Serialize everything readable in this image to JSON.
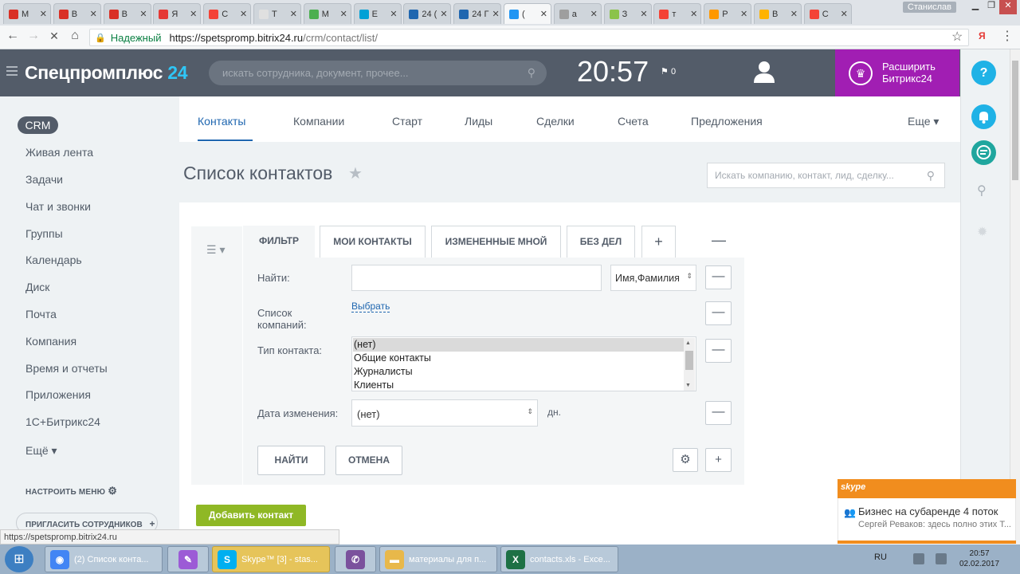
{
  "browser": {
    "tabs": [
      {
        "label": "М",
        "color": "#d93025"
      },
      {
        "label": "В",
        "color": "#d93025"
      },
      {
        "label": "В",
        "color": "#d93025"
      },
      {
        "label": "Я",
        "color": "#e53935"
      },
      {
        "label": "С",
        "color": "#f44336"
      },
      {
        "label": "Т",
        "color": "#e0e0e0"
      },
      {
        "label": "М",
        "color": "#4caf50"
      },
      {
        "label": "Е",
        "color": "#00a1d6"
      },
      {
        "label": "24 (",
        "color": "#2067b0"
      },
      {
        "label": "24 Г",
        "color": "#2067b0"
      },
      {
        "label": "(",
        "color": "#2196f3"
      },
      {
        "label": "а",
        "color": "#9e9e9e"
      },
      {
        "label": "З",
        "color": "#8bc34a"
      },
      {
        "label": "т",
        "color": "#f44336"
      },
      {
        "label": "Р",
        "color": "#ff9800"
      },
      {
        "label": "В",
        "color": "#ffb300"
      },
      {
        "label": "С",
        "color": "#f44336"
      }
    ],
    "window_user": "Станислав",
    "secure_label": "Надежный",
    "url_host": "https://spetspromp.bitrix24.ru",
    "url_path": "/crm/contact/list/",
    "status_url": "https://spetspromp.bitrix24.ru"
  },
  "header": {
    "logo_text": "Спецпромплюс",
    "logo_num": "24",
    "search_placeholder": "искать сотрудника, документ, прочее...",
    "clock": "20:57",
    "flag_count": "0",
    "expand_line1": "Расширить",
    "expand_line2": "Битрикс24",
    "help": "?"
  },
  "leftmenu": {
    "crm": "CRM",
    "items": [
      "Живая лента",
      "Задачи",
      "Чат и звонки",
      "Группы",
      "Календарь",
      "Диск",
      "Почта",
      "Компания",
      "Время и отчеты",
      "Приложения",
      "1С+Битрикс24",
      "Ещё ▾"
    ],
    "configure": "НАСТРОИТЬ МЕНЮ",
    "invite": "ПРИГЛАСИТЬ СОТРУДНИКОВ"
  },
  "topnav": {
    "items": [
      "Контакты",
      "Компании",
      "Старт",
      "Лиды",
      "Сделки",
      "Счета",
      "Предложения"
    ],
    "more": "Еще ▾"
  },
  "page": {
    "title": "Список контактов",
    "search_placeholder": "Искать компанию, контакт, лид, сделку..."
  },
  "filter": {
    "tabs": [
      "ФИЛЬТР",
      "МОИ КОНТАКТЫ",
      "ИЗМЕНЕННЫЕ МНОЙ",
      "БЕЗ ДЕЛ"
    ],
    "find_label": "Найти:",
    "find_field_select": "Имя,Фамилия",
    "companies_label": "Список компаний:",
    "choose_link": "Выбрать",
    "type_label": "Тип контакта:",
    "type_options": [
      "(нет)",
      "Общие контакты",
      "Журналисты",
      "Клиенты"
    ],
    "date_label": "Дата изменения:",
    "date_value": "(нет)",
    "days_suffix": "дн.",
    "find_button": "НАЙТИ",
    "cancel_button": "ОТМЕНА"
  },
  "add_contact": "Добавить контакт",
  "skype": {
    "logo": "skype",
    "title": "Бизнес на субаренде 4 поток",
    "message": "Сергей Реваков: здесь полно этих Т..."
  },
  "taskbar": {
    "items": [
      {
        "label": "(2) Список конта...",
        "icon": "chrome-icon",
        "color": "#4285f4",
        "glyph": "◉"
      },
      {
        "label": "",
        "icon": "feather-icon",
        "color": "#9c5bd6",
        "glyph": "✎"
      },
      {
        "label": "Skype™ [3] - stas...",
        "icon": "skype-icon",
        "color": "#00aff0",
        "glyph": "S"
      },
      {
        "label": "",
        "icon": "viber-icon",
        "color": "#7b519d",
        "glyph": "✆"
      },
      {
        "label": "материалы для п...",
        "icon": "folder-icon",
        "color": "#e8b84a",
        "glyph": "▬"
      },
      {
        "label": "contacts.xls - Exce...",
        "icon": "excel-icon",
        "color": "#1e7145",
        "glyph": "X"
      }
    ],
    "lang": "RU",
    "time": "20:57",
    "date": "02.02.2017"
  }
}
